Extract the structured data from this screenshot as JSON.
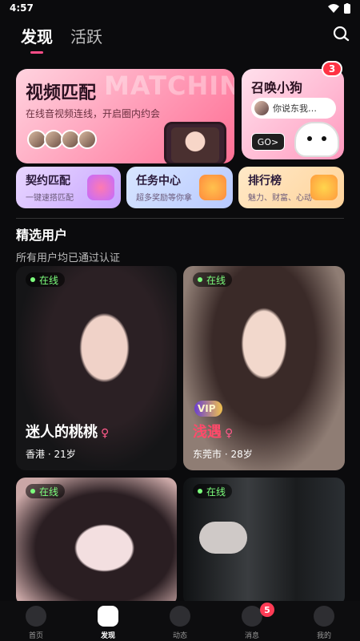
{
  "status": {
    "time": "4:57"
  },
  "top_tabs": [
    {
      "label": "发现",
      "active": true
    },
    {
      "label": "活跃",
      "active": false
    }
  ],
  "banners": {
    "video_match": {
      "watermark": "MATCHIN",
      "title": "视频匹配",
      "subtitle": "在线音视频连线，开启圈内约会"
    },
    "summon_dog": {
      "title": "召唤小狗",
      "chat_text": "你说东我…",
      "go_label": "GO>",
      "badge_count": "3"
    }
  },
  "mini_banners": [
    {
      "title": "契约匹配",
      "subtitle": "一键速搭匹配"
    },
    {
      "title": "任务中心",
      "subtitle": "超多奖励等你拿"
    },
    {
      "title": "排行榜",
      "subtitle": "魅力、财富、心动"
    }
  ],
  "section": {
    "title": "精选用户",
    "subtitle": "所有用户均已通过认证"
  },
  "user_cards": [
    {
      "online_label": "在线",
      "name": "迷人的桃桃",
      "location": "香港 · 21岁",
      "vip": false
    },
    {
      "online_label": "在线",
      "name": "浅遇",
      "location": "东莞市 · 28岁",
      "vip": true,
      "vip_label": "VIP"
    },
    {
      "online_label": "在线"
    },
    {
      "online_label": "在线"
    }
  ],
  "bottom_tabs": [
    {
      "label": "首页",
      "icon": "home-icon"
    },
    {
      "label": "发现",
      "icon": "discover-icon",
      "active": true
    },
    {
      "label": "动态",
      "icon": "moments-icon"
    },
    {
      "label": "消息",
      "icon": "message-icon",
      "badge": "5"
    },
    {
      "label": "我的",
      "icon": "profile-icon"
    }
  ],
  "colors": {
    "accent": "#ff4d88",
    "online": "#7dff7d",
    "badge": "#ff3344"
  }
}
